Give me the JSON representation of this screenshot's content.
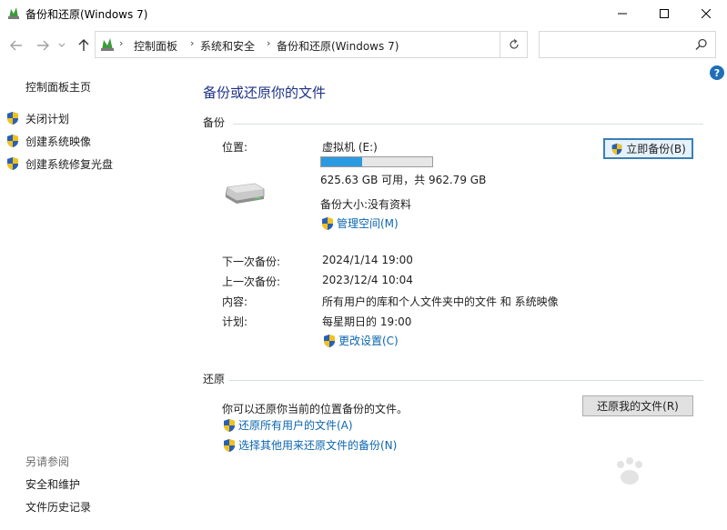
{
  "window": {
    "title": "备份和还原(Windows 7)",
    "minimize_glyph": "—",
    "maximize_glyph": "☐",
    "close_glyph": "✕"
  },
  "nav": {
    "back_icon": "back-arrow-icon",
    "forward_icon": "forward-arrow-icon",
    "recent_icon": "chevron-down-icon",
    "up_icon": "up-arrow-icon",
    "breadcrumbs": [
      "控制面板",
      "系统和安全",
      "备份和还原(Windows 7)"
    ],
    "search_placeholder": "",
    "help_glyph": "?"
  },
  "sidebar": {
    "home": "控制面板主页",
    "links": [
      "关闭计划",
      "创建系统映像",
      "创建系统修复光盘"
    ],
    "see_also_title": "另请参阅",
    "see_also": [
      "安全和维护",
      "文件历史记录"
    ]
  },
  "main": {
    "title": "备份或还原你的文件",
    "backup": {
      "heading": "备份",
      "location_label": "位置:",
      "location_value": "虚拟机 (E:)",
      "usage_fraction": 0.37,
      "space_text": "625.63 GB 可用，共 962.79 GB",
      "size_text": "备份大小:没有资料",
      "manage_space": "管理空间(M)",
      "backup_now_button": "立即备份(B)",
      "next_label": "下一次备份:",
      "next_value": "2024/1/14 19:00",
      "last_label": "上一次备份:",
      "last_value": "2023/12/4 10:04",
      "contents_label": "内容:",
      "contents_value": "所有用户的库和个人文件夹中的文件 和 系统映像",
      "schedule_label": "计划:",
      "schedule_value": "每星期日的 19:00",
      "change_settings": "更改设置(C)"
    },
    "restore": {
      "heading": "还原",
      "description": "你可以还原你当前的位置备份的文件。",
      "restore_my_files_button": "还原我的文件(R)",
      "restore_all_users": "还原所有用户的文件(A)",
      "select_other_backup": "选择其他用来还原文件的备份(N)"
    }
  },
  "colors": {
    "title_blue": "#1e3287",
    "link_blue": "#0b66b0",
    "progress_fill": "#2b9ae0"
  }
}
